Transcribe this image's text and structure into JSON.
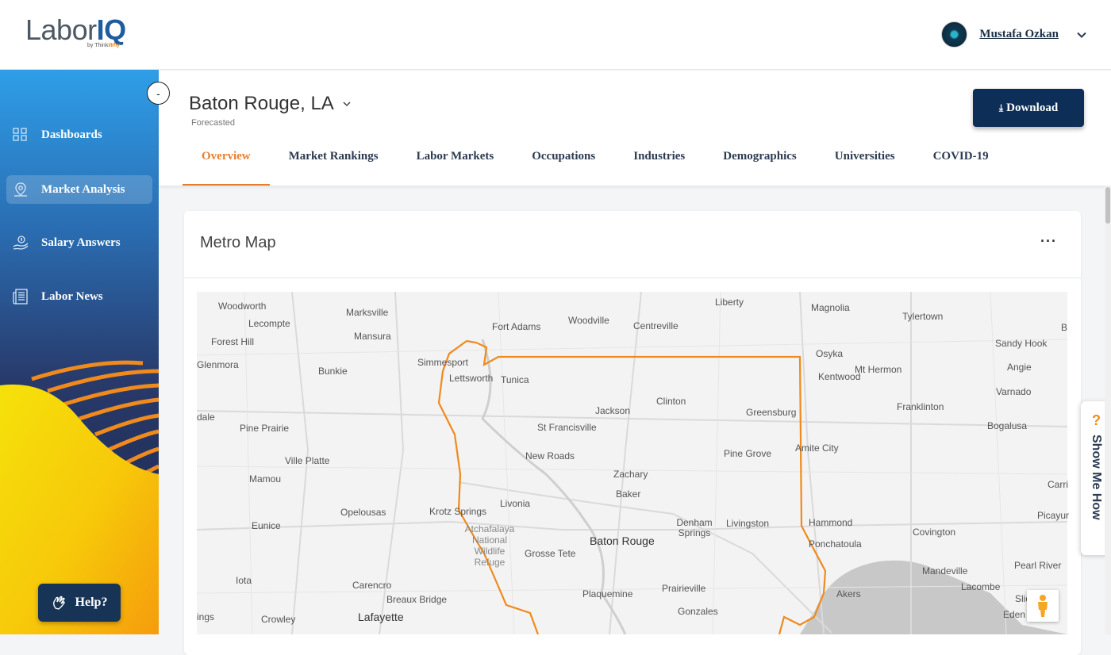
{
  "brand": {
    "labor": "Labor",
    "iq": "IQ",
    "by": "by Think",
    "why": "Why"
  },
  "user": {
    "name": "Mustafa Ozkan"
  },
  "sidebar": {
    "collapse_label": "-",
    "items": [
      {
        "label": "Dashboards",
        "icon": "grid-icon"
      },
      {
        "label": "Market Analysis",
        "icon": "map-pin-icon"
      },
      {
        "label": "Salary Answers",
        "icon": "salary-hand-icon"
      },
      {
        "label": "Labor News",
        "icon": "newspaper-icon"
      }
    ],
    "help_label": "Help?"
  },
  "header": {
    "city": "Baton Rouge, LA",
    "subtitle": "Forecasted",
    "download_label": "Download",
    "tabs": [
      "Overview",
      "Market Rankings",
      "Labor Markets",
      "Occupations",
      "Industries",
      "Demographics",
      "Universities",
      "COVID-19"
    ],
    "active_tab": "Overview"
  },
  "card": {
    "title": "Metro Map",
    "menu": "···"
  },
  "map": {
    "places": [
      "Liberty",
      "Magnolia",
      "Tylertown",
      "Woodworth",
      "Marksville",
      "Fort Adams",
      "Woodville",
      "Centreville",
      "Lecompte",
      "Mansura",
      "Forest Hill",
      "Simmesport",
      "Osyka",
      "Sandy Hook",
      "Glenmora",
      "Bunkie",
      "Lettsworth",
      "Tunica",
      "Kentwood",
      "Mt Hermon",
      "Angie",
      "Varnado",
      "Jackson",
      "Clinton",
      "Greensburg",
      "Franklinton",
      "dale",
      "Pine Prairie",
      "St Francisville",
      "Bogalusa",
      "Ville Platte",
      "New Roads",
      "Pine Grove",
      "Amite City",
      "Mamou",
      "Zachary",
      "Baker",
      "Livonia",
      "Opelousas",
      "Krotz Springs",
      "Eunice",
      "Denham Springs",
      "Livingston",
      "Hammond",
      "Covington",
      "Baton Rouge",
      "Ponchatoula",
      "Grosse Tete",
      "Mandeville",
      "Pearl River",
      "Iota",
      "Carencro",
      "Breaux Bridge",
      "Plaquemine",
      "Prairieville",
      "Akers",
      "Lacombe",
      "Gonzales",
      "Lafayette",
      "Crowley",
      "ings",
      "Eden I",
      "Slid",
      "Carri",
      "Picayur",
      "B",
      "Atchafalaya National Wildlife Refuge"
    ]
  },
  "show_me_how": "Show Me How",
  "colors": {
    "accent": "#e87d2c",
    "navy": "#0d2e57",
    "boundary": "#f08a1c"
  }
}
